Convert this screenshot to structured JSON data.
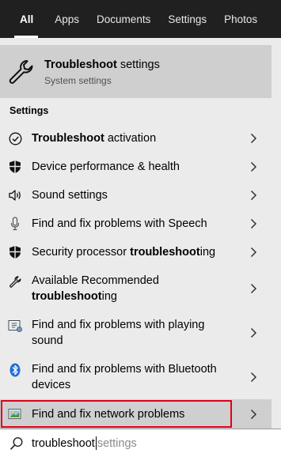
{
  "tabs": [
    {
      "label": "All",
      "active": true
    },
    {
      "label": "Apps",
      "active": false
    },
    {
      "label": "Documents",
      "active": false
    },
    {
      "label": "Settings",
      "active": false
    },
    {
      "label": "Photos",
      "active": false
    }
  ],
  "best_match": {
    "title_bold": "Troubleshoot",
    "title_rest": " settings",
    "subtitle": "System settings",
    "icon": "wrench-icon"
  },
  "section_label": "Settings",
  "results": [
    {
      "icon": "check-circle-icon",
      "bold": "Troubleshoot",
      "rest": " activation"
    },
    {
      "icon": "shield-icon",
      "text": "Device performance & health"
    },
    {
      "icon": "speaker-icon",
      "text": "Sound settings"
    },
    {
      "icon": "microphone-icon",
      "text": "Find and fix problems with Speech"
    },
    {
      "icon": "shield-icon",
      "pre": "Security processor ",
      "bold": "troubleshoot",
      "rest": "ing"
    },
    {
      "icon": "wrench-icon",
      "line1": "Available Recommended",
      "bold": "troubleshoot",
      "rest": "ing"
    },
    {
      "icon": "playback-icon",
      "line1": "Find and fix problems with playing",
      "line2": "sound"
    },
    {
      "icon": "bluetooth-icon",
      "line1": "Find and fix problems with Bluetooth",
      "line2": "devices"
    },
    {
      "icon": "network-icon",
      "text": "Find and fix network problems",
      "selected": true
    }
  ],
  "search": {
    "typed": "troubleshoot",
    "suggestion": "settings",
    "icon": "search-icon"
  },
  "colors": {
    "taskbar": "#202020",
    "selection": "#cfcfcf",
    "panel": "#ebebeb",
    "highlight_box": "#e0001a",
    "bluetooth": "#1e6fd9"
  }
}
